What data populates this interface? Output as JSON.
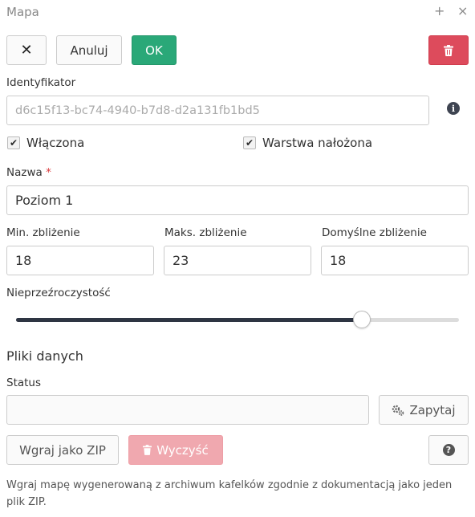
{
  "window": {
    "title": "Mapa",
    "plus_glyph": "+",
    "close_glyph": "×"
  },
  "toolbar": {
    "close_glyph": "✕",
    "cancel_label": "Anuluj",
    "ok_label": "OK",
    "delete_icon": "trash-icon",
    "colors": {
      "ok": "#2aa878",
      "delete": "#dd4b5c"
    }
  },
  "identifier": {
    "label": "Identyfikator",
    "value": "d6c15f13-bc74-4940-b7d8-d2a131fb1bd5",
    "info_glyph": "i"
  },
  "checkboxes": {
    "enabled": {
      "label": "Włączona",
      "checked": true
    },
    "overlay": {
      "label": "Warstwa nałożona",
      "checked": true
    }
  },
  "name": {
    "label": "Nazwa",
    "required_mark": "*",
    "value": "Poziom 1"
  },
  "zoom": {
    "min": {
      "label": "Min. zbliżenie",
      "value": "18"
    },
    "max": {
      "label": "Maks. zbliżenie",
      "value": "23"
    },
    "default": {
      "label": "Domyślne zbliżenie",
      "value": "18"
    }
  },
  "opacity": {
    "label": "Nieprzeźroczystość",
    "value": 0.78
  },
  "data_files": {
    "section_title": "Pliki danych",
    "status_label": "Status",
    "status_value": "",
    "query_label": "Zapytaj",
    "upload_label": "Wgraj jako ZIP",
    "clear_label": "Wyczyść",
    "help_glyph": "?",
    "help_text": "Wgraj mapę wygenerowaną z archiwum kafelków zgodnie z dokumentacją jako jeden plik ZIP."
  }
}
